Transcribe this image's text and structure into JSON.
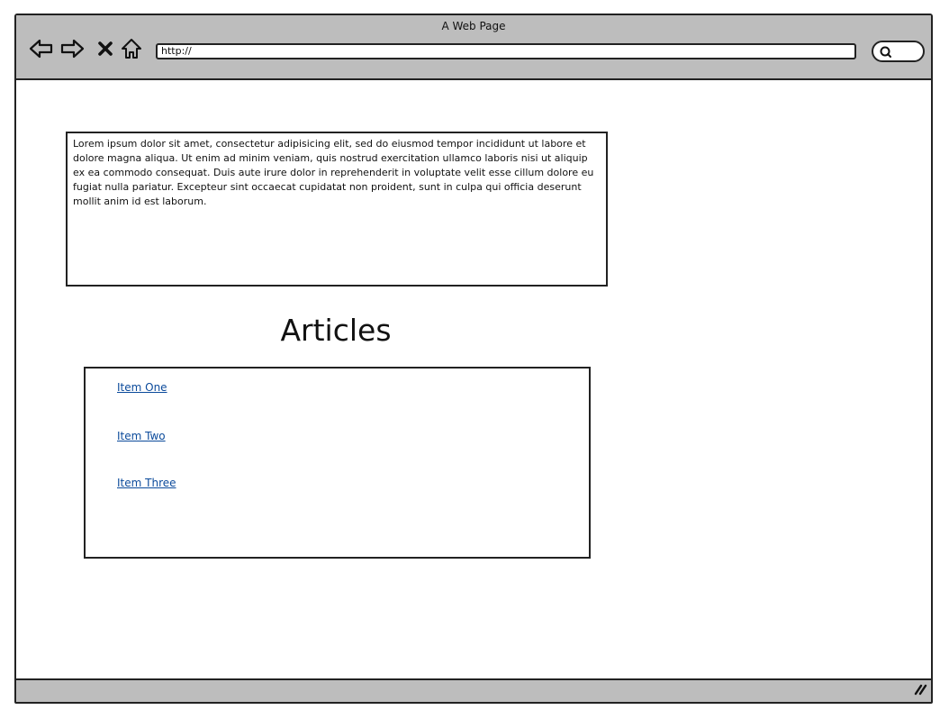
{
  "window": {
    "title": "A Web Page"
  },
  "toolbar": {
    "icons": [
      "back-arrow-icon",
      "forward-arrow-icon",
      "stop-icon",
      "home-icon"
    ],
    "address_value": "http://",
    "search_icon": "search-icon"
  },
  "content": {
    "paragraph": "Lorem ipsum dolor sit amet, consectetur adipisicing elit, sed do eiusmod tempor incididunt ut labore et dolore magna aliqua. Ut enim ad minim veniam, quis nostrud exercitation ullamco laboris nisi ut aliquip ex ea commodo consequat. Duis aute irure dolor in reprehenderit in voluptate velit esse cillum dolore eu fugiat nulla pariatur. Excepteur sint occaecat cupidatat non proident, sunt in culpa qui officia deserunt mollit anim id est laborum.",
    "heading": "Articles",
    "articles": [
      {
        "label": "Item One"
      },
      {
        "label": "Item Two"
      },
      {
        "label": "Item Three"
      }
    ]
  },
  "colors": {
    "chrome": "#bdbdbd",
    "link": "#0b4a9b",
    "border": "#222222"
  }
}
